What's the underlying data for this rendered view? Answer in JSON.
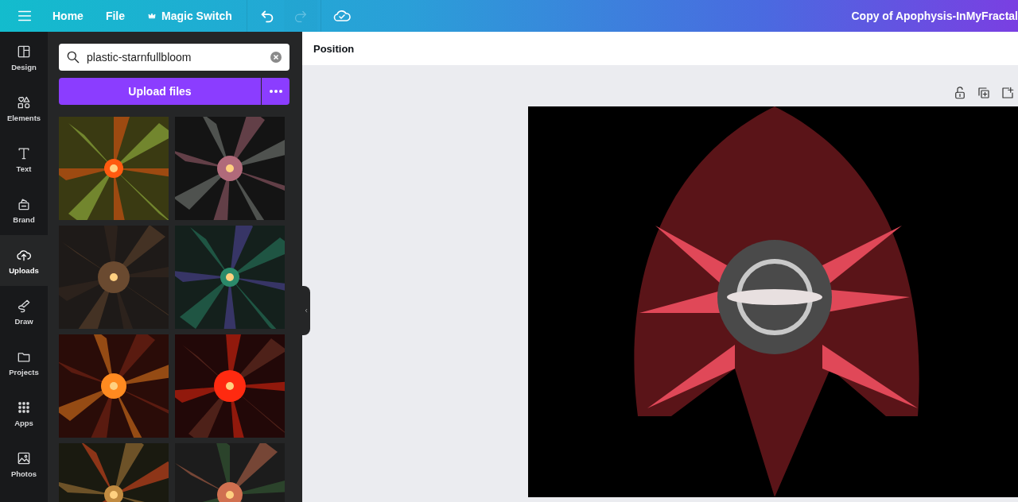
{
  "top_bar": {
    "nav": [
      {
        "label": "Home",
        "kind": "text"
      },
      {
        "label": "File",
        "kind": "text"
      },
      {
        "label": "Magic Switch",
        "kind": "crown"
      }
    ],
    "history": [
      {
        "kind": "undo",
        "disabled": false
      },
      {
        "kind": "redo",
        "disabled": true
      }
    ],
    "title": "Copy of Apophysis-InMyFractal"
  },
  "sidebar": {
    "items": [
      {
        "label": "Design",
        "selected": false
      },
      {
        "label": "Elements",
        "selected": false
      },
      {
        "label": "Text",
        "selected": false
      },
      {
        "label": "Brand",
        "selected": false
      },
      {
        "label": "Uploads",
        "selected": true
      },
      {
        "label": "Draw",
        "selected": false
      },
      {
        "label": "Projects",
        "selected": false
      },
      {
        "label": "Apps",
        "selected": false
      },
      {
        "label": "Photos",
        "selected": false
      }
    ]
  },
  "panel": {
    "search": {
      "value": "plastic-starnfullbloom"
    },
    "upload_button": "Upload files"
  },
  "editor": {
    "toolbar": {
      "position_button": "Position"
    }
  }
}
